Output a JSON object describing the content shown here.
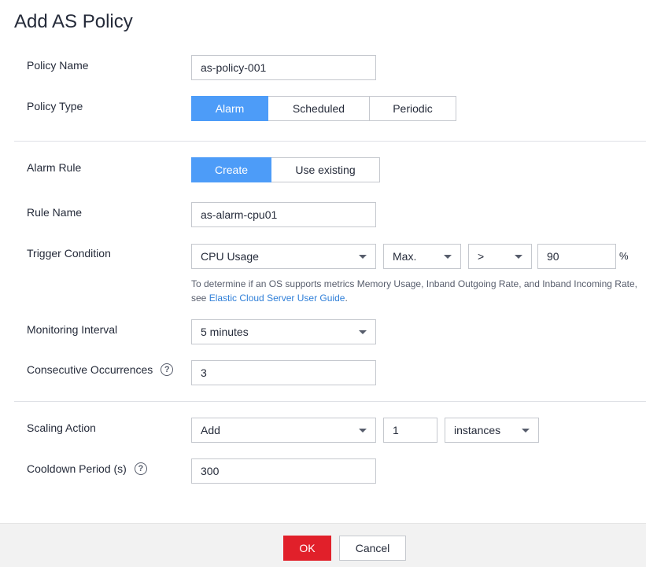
{
  "dialog": {
    "title": "Add AS Policy"
  },
  "policy_name": {
    "label": "Policy Name",
    "value": "as-policy-001"
  },
  "policy_type": {
    "label": "Policy Type",
    "options": [
      "Alarm",
      "Scheduled",
      "Periodic"
    ],
    "selected": "Alarm"
  },
  "alarm_rule": {
    "label": "Alarm Rule",
    "options": [
      "Create",
      "Use existing"
    ],
    "selected": "Create"
  },
  "rule_name": {
    "label": "Rule Name",
    "value": "as-alarm-cpu01"
  },
  "trigger_condition": {
    "label": "Trigger Condition",
    "metric": "CPU Usage",
    "statistic": "Max.",
    "operator": ">",
    "threshold": "90",
    "unit": "%",
    "note_text": "To determine if an OS supports metrics Memory Usage, Inband Outgoing Rate, and Inband Incoming Rate, see",
    "note_link": "Elastic Cloud Server User Guide",
    "note_end": "."
  },
  "monitoring_interval": {
    "label": "Monitoring Interval",
    "value": "5 minutes"
  },
  "consecutive_occurrences": {
    "label": "Consecutive Occurrences",
    "value": "3"
  },
  "scaling_action": {
    "label": "Scaling Action",
    "action": "Add",
    "count": "1",
    "unit": "instances"
  },
  "cooldown_period": {
    "label": "Cooldown Period (s)",
    "value": "300"
  },
  "footer": {
    "ok_label": "OK",
    "cancel_label": "Cancel"
  },
  "colors": {
    "primary": "#4d9cf8",
    "danger": "#e1202a",
    "link": "#2f7fd8"
  }
}
